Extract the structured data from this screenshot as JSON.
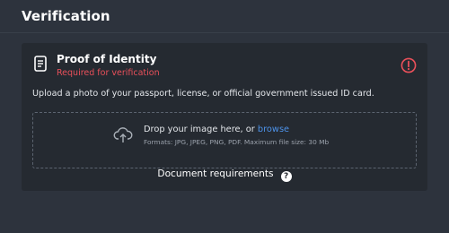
{
  "page": {
    "title": "Verification"
  },
  "card": {
    "title": "Proof of Identity",
    "subtitle": "Required for verification",
    "icons": {
      "document": "document-icon",
      "alert": "alert-circle-icon"
    },
    "instructions": "Upload a photo of your passport, license, or official government issued ID card."
  },
  "dropzone": {
    "icon": "cloud-upload-icon",
    "prompt_prefix": "Drop your image here, or ",
    "browse_label": "browse",
    "formats": "Formats: JPG, JPEG, PNG, PDF. Maximum file size: 30 Mb"
  },
  "requirements": {
    "label": "Document requirements",
    "help_icon_text": "?"
  },
  "colors": {
    "background": "#2d333d",
    "card": "#252a31",
    "error": "#e9505a",
    "link": "#4d93ea"
  }
}
